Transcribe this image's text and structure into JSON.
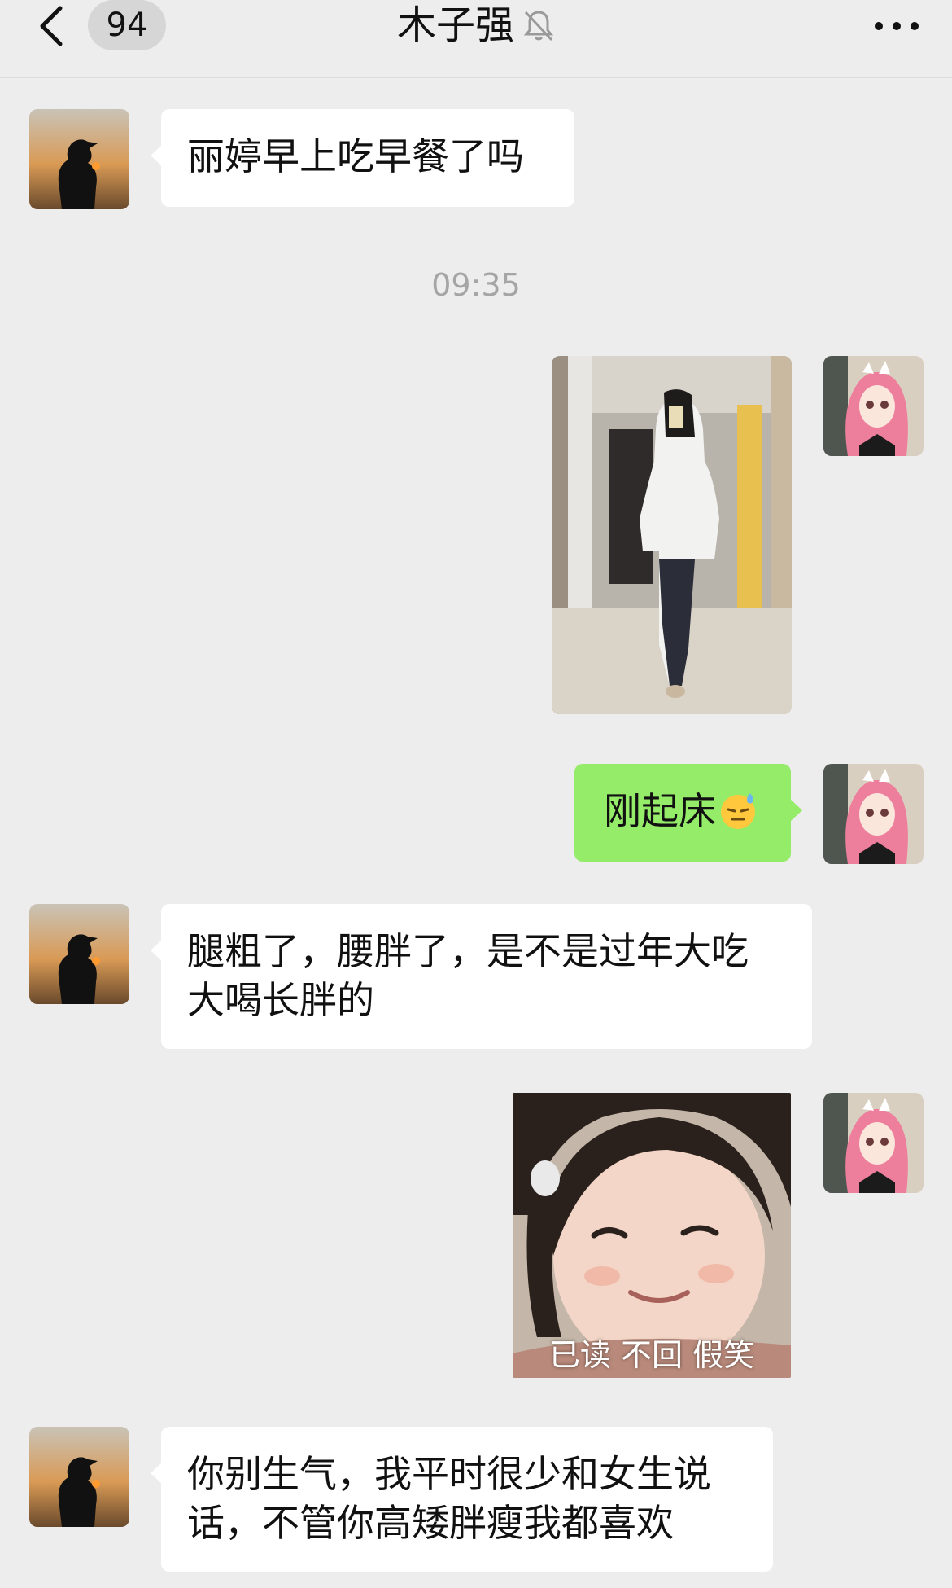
{
  "header": {
    "unread_count": "94",
    "title": "木子强",
    "icons": {
      "back": "chevron-left-icon",
      "mute": "bell-muted-icon",
      "more": "more-dots-icon"
    }
  },
  "messages": [
    {
      "from": "other",
      "type": "text",
      "text": "丽婷早上吃早餐了吗"
    },
    {
      "type": "timestamp",
      "text": "09:35"
    },
    {
      "from": "self",
      "type": "image",
      "alt": "mirror-selfie-photo"
    },
    {
      "from": "self",
      "type": "text",
      "text": "刚起床",
      "emoji": "sweat-smile-emoji"
    },
    {
      "from": "other",
      "type": "text",
      "line1": "腿粗了，腰胖了，是不是过年大吃",
      "line2": "大喝长胖的"
    },
    {
      "from": "self",
      "type": "sticker",
      "caption": "已读 不回 假笑"
    },
    {
      "from": "other",
      "type": "text",
      "line1": "你别生气，我平时很少和女生说",
      "line2": "话，不管你高矮胖瘦我都喜欢"
    }
  ],
  "colors": {
    "background": "#ededed",
    "self_bubble": "#95ec69",
    "other_bubble": "#ffffff",
    "timestamp": "#a5a5a5"
  }
}
